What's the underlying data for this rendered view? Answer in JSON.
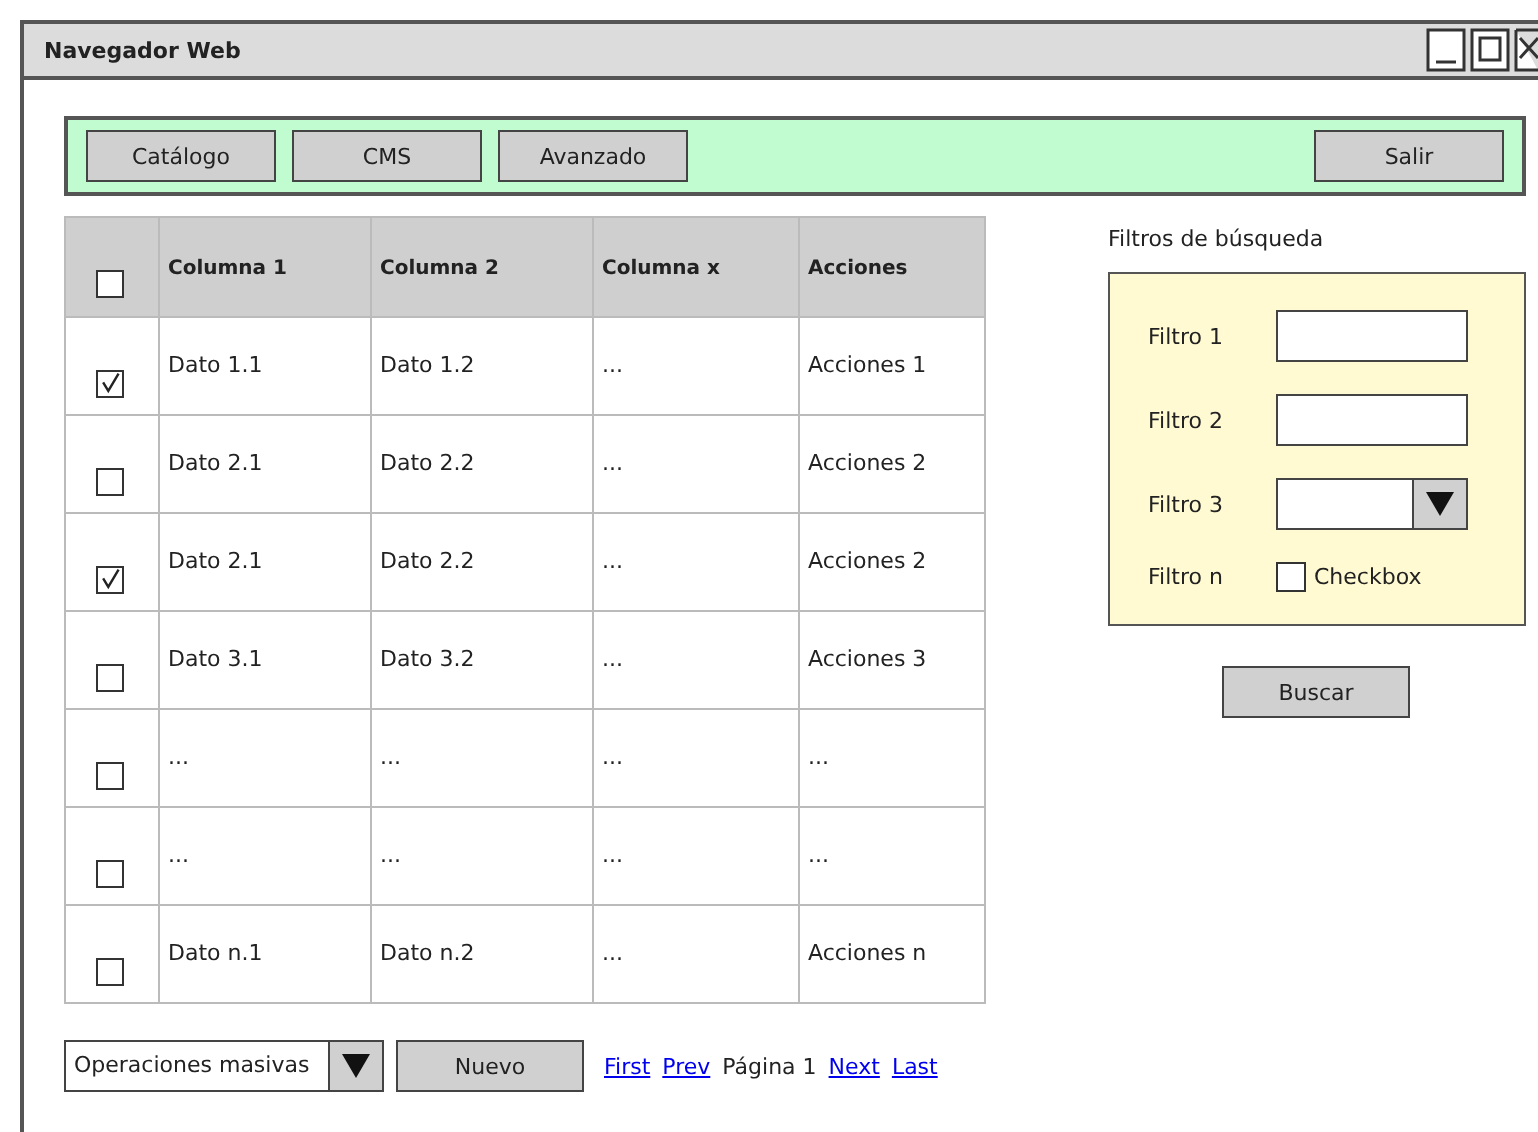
{
  "window": {
    "title": "Navegador Web"
  },
  "toolbar": {
    "buttons": [
      "Catálogo",
      "CMS",
      "Avanzado"
    ],
    "exit_button": "Salir"
  },
  "table": {
    "header_checked": false,
    "columns": [
      "Columna 1",
      "Columna 2",
      "Columna x",
      "Acciones"
    ],
    "rows": [
      {
        "checked": true,
        "cells": [
          "Dato 1.1",
          "Dato 1.2",
          "...",
          "Acciones 1"
        ]
      },
      {
        "checked": false,
        "cells": [
          "Dato 2.1",
          "Dato 2.2",
          "...",
          "Acciones 2"
        ]
      },
      {
        "checked": true,
        "cells": [
          "Dato 2.1",
          "Dato 2.2",
          "...",
          "Acciones 2"
        ]
      },
      {
        "checked": false,
        "cells": [
          "Dato 3.1",
          "Dato 3.2",
          "...",
          "Acciones 3"
        ]
      },
      {
        "checked": false,
        "cells": [
          "...",
          "...",
          "...",
          "..."
        ]
      },
      {
        "checked": false,
        "cells": [
          "...",
          "...",
          "...",
          "..."
        ]
      },
      {
        "checked": false,
        "cells": [
          "Dato n.1",
          "Dato n.2",
          "...",
          "Acciones n"
        ]
      }
    ]
  },
  "filters": {
    "title": "Filtros de búsqueda",
    "items": [
      {
        "kind": "text",
        "label": "Filtro 1"
      },
      {
        "kind": "text",
        "label": "Filtro 2"
      },
      {
        "kind": "select",
        "label": "Filtro 3"
      },
      {
        "kind": "checkbox",
        "label": "Filtro n",
        "option": "Checkbox",
        "checked": false
      }
    ],
    "search_button": "Buscar"
  },
  "footer": {
    "bulk_select": "Operaciones masivas",
    "new_button": "Nuevo",
    "pager": [
      {
        "kind": "link",
        "text": "First"
      },
      {
        "kind": "link",
        "text": "Prev"
      },
      {
        "kind": "text",
        "text": "Página 1"
      },
      {
        "kind": "link",
        "text": "Next"
      },
      {
        "kind": "link",
        "text": "Last"
      }
    ]
  }
}
